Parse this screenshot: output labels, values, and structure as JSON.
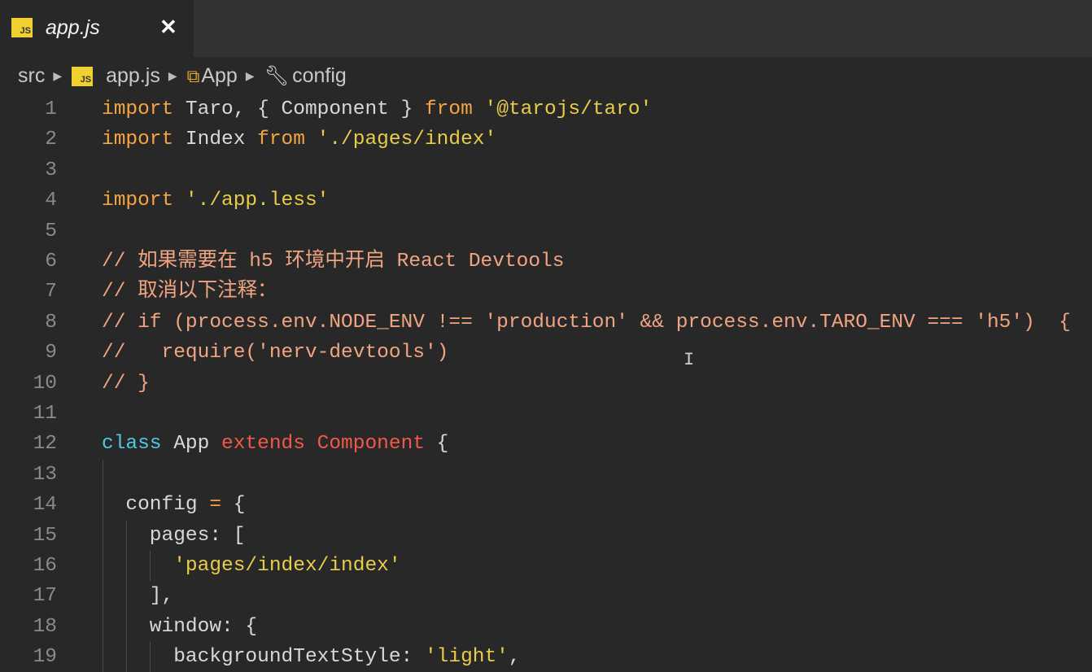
{
  "tab": {
    "icon": "JS",
    "name": "app.js",
    "close": "✕"
  },
  "breadcrumb": [
    {
      "label": "src",
      "icon": "none"
    },
    {
      "label": "app.js",
      "icon": "js-file-icon",
      "icon_text": "JS"
    },
    {
      "label": "App",
      "icon": "class-icon"
    },
    {
      "label": "config",
      "icon": "wrench-icon"
    }
  ],
  "colors": {
    "keyword": "#f5a442",
    "string": "#e8cc4a",
    "comment": "#f0a482",
    "class": "#4ec9e6",
    "extends": "#f2584a",
    "background": "#282828"
  },
  "lines": [
    {
      "n": "1",
      "tokens": [
        [
          "kw",
          "import"
        ],
        [
          "id",
          " Taro, { Component } "
        ],
        [
          "kw",
          "from"
        ],
        [
          "id",
          " "
        ],
        [
          "str",
          "'@tarojs/taro'"
        ]
      ]
    },
    {
      "n": "2",
      "tokens": [
        [
          "kw",
          "import"
        ],
        [
          "id",
          " Index "
        ],
        [
          "kw",
          "from"
        ],
        [
          "id",
          " "
        ],
        [
          "str",
          "'./pages/index'"
        ]
      ]
    },
    {
      "n": "3",
      "tokens": []
    },
    {
      "n": "4",
      "tokens": [
        [
          "kw",
          "import"
        ],
        [
          "id",
          " "
        ],
        [
          "str",
          "'./app.less'"
        ]
      ]
    },
    {
      "n": "5",
      "tokens": []
    },
    {
      "n": "6",
      "tokens": [
        [
          "cmt",
          "// 如果需要在 h5 环境中开启 React Devtools"
        ]
      ]
    },
    {
      "n": "7",
      "tokens": [
        [
          "cmt",
          "// 取消以下注释："
        ]
      ]
    },
    {
      "n": "8",
      "tokens": [
        [
          "cmt",
          "// if (process.env.NODE_ENV !== 'production' && process.env.TARO_ENV === 'h5')  {"
        ]
      ]
    },
    {
      "n": "9",
      "tokens": [
        [
          "cmt",
          "//   require('nerv-devtools')"
        ]
      ]
    },
    {
      "n": "10",
      "tokens": [
        [
          "cmt",
          "// }"
        ]
      ]
    },
    {
      "n": "11",
      "tokens": []
    },
    {
      "n": "12",
      "tokens": [
        [
          "cls",
          "class"
        ],
        [
          "id",
          " App "
        ],
        [
          "ext",
          "extends"
        ],
        [
          "id",
          " "
        ],
        [
          "ext",
          "Component"
        ],
        [
          "id",
          " {"
        ]
      ]
    },
    {
      "n": "13",
      "tokens": []
    },
    {
      "n": "14",
      "tokens": [
        [
          "id",
          "  config "
        ],
        [
          "op",
          "="
        ],
        [
          "id",
          " {"
        ]
      ]
    },
    {
      "n": "15",
      "tokens": [
        [
          "id",
          "    pages: ["
        ]
      ]
    },
    {
      "n": "16",
      "tokens": [
        [
          "id",
          "      "
        ],
        [
          "str",
          "'pages/index/index'"
        ]
      ]
    },
    {
      "n": "17",
      "tokens": [
        [
          "id",
          "    ],"
        ]
      ]
    },
    {
      "n": "18",
      "tokens": [
        [
          "id",
          "    window: {"
        ]
      ]
    },
    {
      "n": "19",
      "tokens": [
        [
          "id",
          "      backgroundTextStyle: "
        ],
        [
          "str",
          "'light'"
        ],
        [
          "id",
          ","
        ]
      ]
    }
  ]
}
